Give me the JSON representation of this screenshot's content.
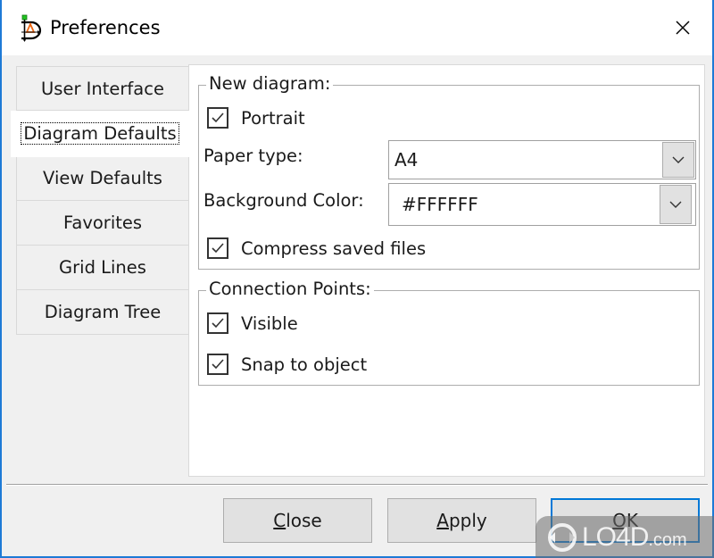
{
  "window": {
    "title": "Preferences",
    "app_icon": "dia-app-icon",
    "close_icon": "close-icon"
  },
  "tabs": [
    {
      "label": "User Interface",
      "active": false
    },
    {
      "label": "Diagram Defaults",
      "active": true
    },
    {
      "label": "View Defaults",
      "active": false
    },
    {
      "label": "Favorites",
      "active": false
    },
    {
      "label": "Grid Lines",
      "active": false
    },
    {
      "label": "Diagram Tree",
      "active": false
    }
  ],
  "new_diagram": {
    "legend": "New diagram:",
    "portrait": {
      "label": "Portrait",
      "checked": true
    },
    "paper_type": {
      "label": "Paper type:",
      "value": "A4"
    },
    "background_color": {
      "label": "Background Color:",
      "value": "#FFFFFF"
    },
    "compress": {
      "label": "Compress saved files",
      "checked": true
    }
  },
  "connection_points": {
    "legend": "Connection Points:",
    "visible": {
      "label": "Visible",
      "checked": true
    },
    "snap": {
      "label": "Snap to object",
      "checked": true
    }
  },
  "buttons": {
    "close": {
      "mnemonic": "C",
      "rest": "lose"
    },
    "apply": {
      "mnemonic": "A",
      "rest": "pply"
    },
    "ok": {
      "mnemonic": "O",
      "rest": "K"
    }
  },
  "watermark": {
    "brand": "LO4D",
    "suffix": ".com"
  },
  "colors": {
    "accent": "#0078d7",
    "window_border": "#1e7ad6"
  }
}
